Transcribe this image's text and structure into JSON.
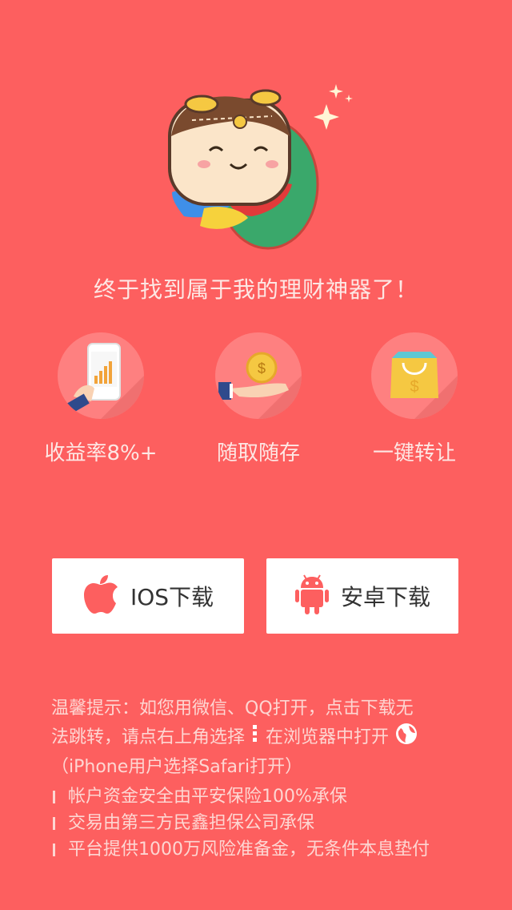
{
  "hero": {
    "slogan": "终于找到属于我的理财神器了！",
    "mascot": "mascot-flying-character"
  },
  "features": [
    {
      "label": "收益率8%+",
      "icon": "phone-chart-icon"
    },
    {
      "label": "随取随存",
      "icon": "hand-coin-icon"
    },
    {
      "label": "一键转让",
      "icon": "shopping-bag-icon"
    }
  ],
  "downloads": {
    "ios_label": "IOS下载",
    "android_label": "安卓下载",
    "ios_icon": "apple-icon",
    "android_icon": "android-icon"
  },
  "tips": {
    "line1": "温馨提示：如您用微信、QQ打开，点击下载无",
    "line2_a": "法跳转，请点右上角选择",
    "line2_b": "在浏览器中打开",
    "line3": "（iPhone用户选择Safari打开）"
  },
  "bullets": [
    "帐户资金安全由平安保险100%承保",
    "交易由第三方民鑫担保公司承保",
    "平台提供1000万风险准备金，无条件本息垫付"
  ],
  "colors": {
    "background": "#fd5f5f",
    "circle": "#fe8080",
    "button_bg": "#ffffff",
    "button_icon": "#fd5f5f",
    "mascot_green": "#3aa86b"
  }
}
